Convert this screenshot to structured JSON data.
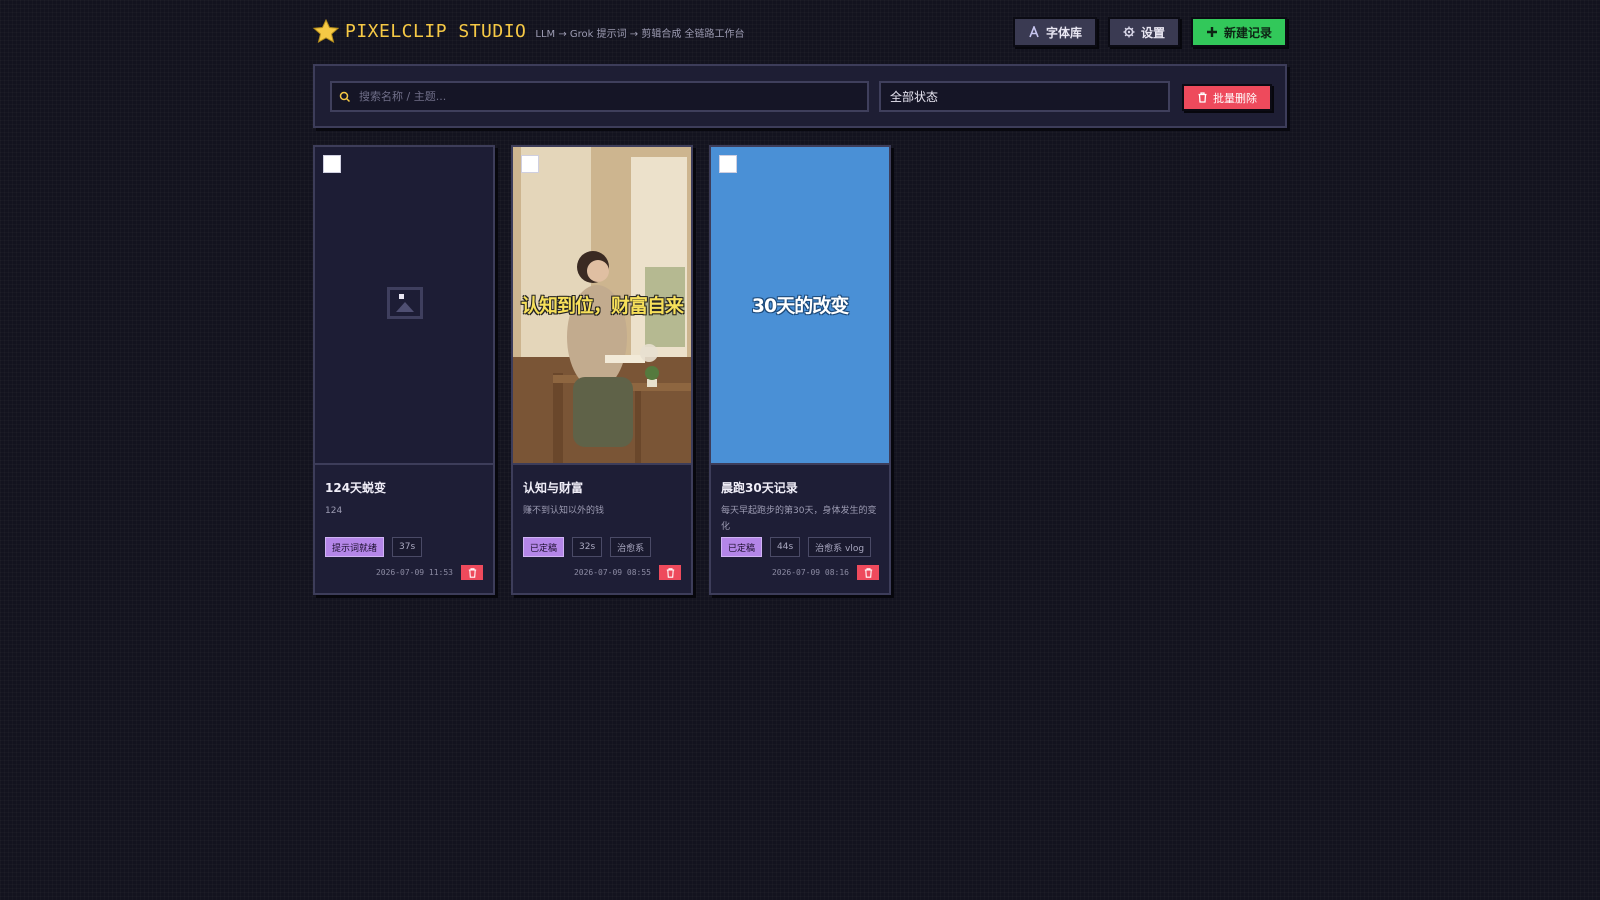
{
  "header": {
    "brand": "PIXELCLIP STUDIO",
    "subtitle": "LLM → Grok 提示词 → 剪辑合成 全链路工作台",
    "font_lib_label": "字体库",
    "settings_label": "设置",
    "new_label": "新建记录"
  },
  "filter": {
    "search_placeholder": "搜索名称 / 主题...",
    "search_value": "",
    "status_selected": "全部状态",
    "bulk_delete_label": "批量删除"
  },
  "cards": [
    {
      "title": "124天蜕变",
      "desc": "124",
      "status": "提示词就绪",
      "duration": "37s",
      "theme": "",
      "timestamp": "2026-07-09 11:53",
      "thumb_caption": "",
      "thumb_type": "empty"
    },
    {
      "title": "认知与财富",
      "desc": "赚不到认知以外的钱",
      "status": "已定稿",
      "duration": "32s",
      "theme": "治愈系",
      "timestamp": "2026-07-09 08:55",
      "thumb_caption": "认知到位，财富自来",
      "thumb_type": "photo"
    },
    {
      "title": "晨跑30天记录",
      "desc": "每天早起跑步的第30天，身体发生的变化",
      "status": "已定稿",
      "duration": "44s",
      "theme": "治愈系 vlog",
      "timestamp": "2026-07-09 08:16",
      "thumb_caption": "30天的改变",
      "thumb_type": "blue"
    }
  ],
  "colors": {
    "background": "#13131f",
    "brand": "#f6c945",
    "primary": "#32c85a",
    "danger": "#ee4a5c",
    "status_tag": "#b486e8",
    "thumb_blue": "#4a90d6"
  },
  "icons": {
    "brand": "star-icon",
    "font_lib": "font-icon",
    "settings": "gear-icon",
    "new": "plus-icon",
    "search": "search-icon",
    "delete": "trash-icon",
    "placeholder": "image-placeholder-icon"
  }
}
